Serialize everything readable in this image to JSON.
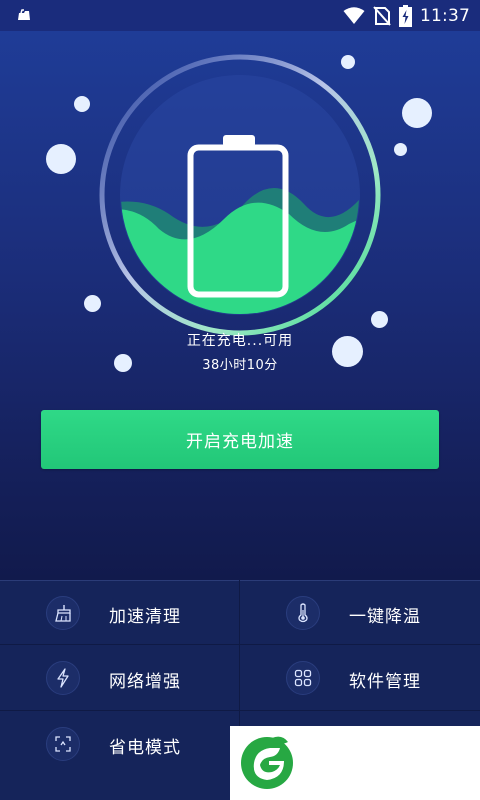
{
  "status_bar": {
    "time": "11:37",
    "icons": [
      "notification-icon",
      "wifi-icon",
      "no-sim-icon",
      "battery-charging-icon"
    ]
  },
  "charging": {
    "status_text": "正在充电...可用",
    "remaining_time": "38小时10分",
    "level_percent": 50
  },
  "boost_button": {
    "label": "开启充电加速"
  },
  "features": [
    {
      "label": "加速清理",
      "icon": "broom-icon"
    },
    {
      "label": "一键降温",
      "icon": "thermometer-icon"
    },
    {
      "label": "网络增强",
      "icon": "lightning-icon"
    },
    {
      "label": "软件管理",
      "icon": "apps-grid-icon"
    },
    {
      "label": "省电模式",
      "icon": "power-save-icon"
    }
  ],
  "colors": {
    "accent_green": "#2fd987",
    "background_top": "#1f3c97",
    "background_bottom": "#111a4c",
    "grid_background": "#15245a"
  }
}
